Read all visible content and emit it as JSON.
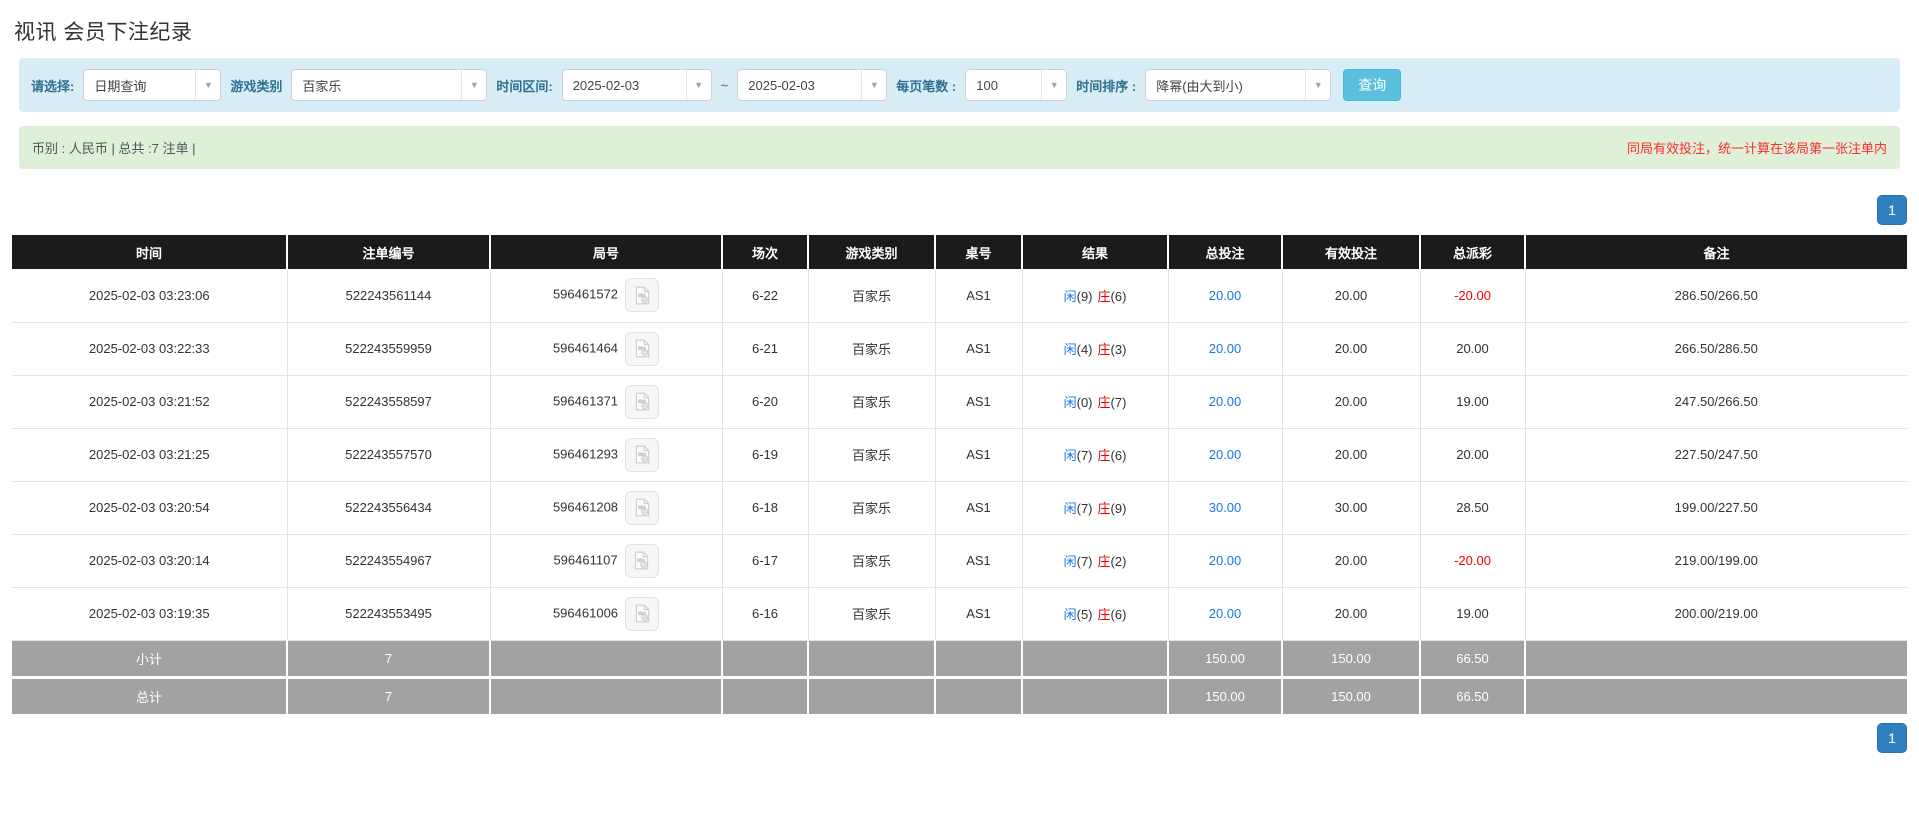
{
  "page": {
    "title": "视讯 会员下注纪录"
  },
  "filters": {
    "select_label": "请选择:",
    "select_value": "日期查询",
    "game_label": "游戏类别",
    "game_value": "百家乐",
    "range_label": "时间区间:",
    "date_from": "2025-02-03",
    "tilde": "~",
    "date_to": "2025-02-03",
    "per_page_label": "每页笔数 :",
    "per_page_value": "100",
    "sort_label": "时间排序 :",
    "sort_value": "降幂(由大到小)",
    "search_button": "查询",
    "dropdown_arrow": "▼"
  },
  "summary": {
    "left": "币别 : 人民币 | 总共 :7 注单 |",
    "right": "同局有效投注，统一计算在该局第一张注单内"
  },
  "pagination": {
    "page": "1"
  },
  "table": {
    "headers": [
      "时间",
      "注单编号",
      "局号",
      "场次",
      "游戏类别",
      "桌号",
      "结果",
      "总投注",
      "有效投注",
      "总派彩",
      "备注"
    ],
    "rows": [
      {
        "time": "2025-02-03 03:23:06",
        "bet_id": "522243561144",
        "round_id": "596461572",
        "session": "6-22",
        "game": "百家乐",
        "table_no": "AS1",
        "player": "闲",
        "player_n": "(9)",
        "banker": "庄",
        "banker_n": "(6)",
        "total_bet": "20.00",
        "valid_bet": "20.00",
        "payout": "-20.00",
        "remark": "286.50/266.50"
      },
      {
        "time": "2025-02-03 03:22:33",
        "bet_id": "522243559959",
        "round_id": "596461464",
        "session": "6-21",
        "game": "百家乐",
        "table_no": "AS1",
        "player": "闲",
        "player_n": "(4)",
        "banker": "庄",
        "banker_n": "(3)",
        "total_bet": "20.00",
        "valid_bet": "20.00",
        "payout": "20.00",
        "remark": "266.50/286.50"
      },
      {
        "time": "2025-02-03 03:21:52",
        "bet_id": "522243558597",
        "round_id": "596461371",
        "session": "6-20",
        "game": "百家乐",
        "table_no": "AS1",
        "player": "闲",
        "player_n": "(0)",
        "banker": "庄",
        "banker_n": "(7)",
        "total_bet": "20.00",
        "valid_bet": "20.00",
        "payout": "19.00",
        "remark": "247.50/266.50"
      },
      {
        "time": "2025-02-03 03:21:25",
        "bet_id": "522243557570",
        "round_id": "596461293",
        "session": "6-19",
        "game": "百家乐",
        "table_no": "AS1",
        "player": "闲",
        "player_n": "(7)",
        "banker": "庄",
        "banker_n": "(6)",
        "total_bet": "20.00",
        "valid_bet": "20.00",
        "payout": "20.00",
        "remark": "227.50/247.50"
      },
      {
        "time": "2025-02-03 03:20:54",
        "bet_id": "522243556434",
        "round_id": "596461208",
        "session": "6-18",
        "game": "百家乐",
        "table_no": "AS1",
        "player": "闲",
        "player_n": "(7)",
        "banker": "庄",
        "banker_n": "(9)",
        "total_bet": "30.00",
        "valid_bet": "30.00",
        "payout": "28.50",
        "remark": "199.00/227.50"
      },
      {
        "time": "2025-02-03 03:20:14",
        "bet_id": "522243554967",
        "round_id": "596461107",
        "session": "6-17",
        "game": "百家乐",
        "table_no": "AS1",
        "player": "闲",
        "player_n": "(7)",
        "banker": "庄",
        "banker_n": "(2)",
        "total_bet": "20.00",
        "valid_bet": "20.00",
        "payout": "-20.00",
        "remark": "219.00/199.00"
      },
      {
        "time": "2025-02-03 03:19:35",
        "bet_id": "522243553495",
        "round_id": "596461006",
        "session": "6-16",
        "game": "百家乐",
        "table_no": "AS1",
        "player": "闲",
        "player_n": "(5)",
        "banker": "庄",
        "banker_n": "(6)",
        "total_bet": "20.00",
        "valid_bet": "20.00",
        "payout": "19.00",
        "remark": "200.00/219.00"
      }
    ],
    "subtotal": {
      "label": "小计",
      "count": "7",
      "total_bet": "150.00",
      "valid_bet": "150.00",
      "payout": "66.50"
    },
    "total": {
      "label": "总计",
      "count": "7",
      "total_bet": "150.00",
      "valid_bet": "150.00",
      "payout": "66.50"
    }
  },
  "colors": {
    "accent_blue": "#1d76e2",
    "banker_red": "#e60000",
    "negative_red": "#f20000",
    "filter_bg": "#d9edf7",
    "summary_bg": "#dff0d8",
    "header_bg": "#1b1b1b",
    "footer_bg": "#a2a2a2",
    "button_cyan": "#5bc0de",
    "pager_blue": "#2f7fc1"
  }
}
